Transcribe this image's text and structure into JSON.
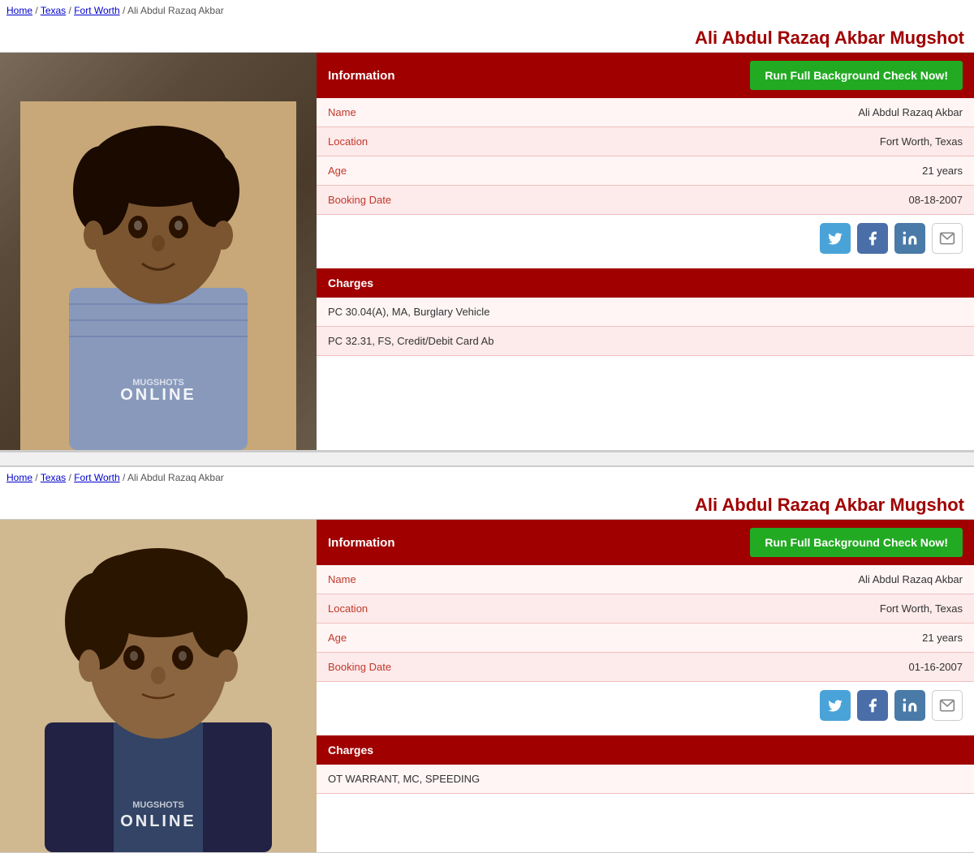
{
  "records": [
    {
      "breadcrumb": {
        "home": "Home",
        "state": "Texas",
        "city": "Fort Worth",
        "name": "Ali Abdul Razaq Akbar"
      },
      "page_title": "Ali Abdul Razaq Akbar Mugshot",
      "info_label": "Information",
      "bg_check_label": "Run Full Background Check Now!",
      "fields": [
        {
          "label": "Name",
          "value": "Ali Abdul Razaq Akbar"
        },
        {
          "label": "Location",
          "value": "Fort Worth, Texas"
        },
        {
          "label": "Age",
          "value": "21 years"
        },
        {
          "label": "Booking Date",
          "value": "08-18-2007"
        }
      ],
      "charges_label": "Charges",
      "charges": [
        "PC 30.04(A), MA, Burglary Vehicle",
        "PC 32.31, FS, Credit/Debit Card Ab"
      ],
      "mugshot_style": "1"
    },
    {
      "breadcrumb": {
        "home": "Home",
        "state": "Texas",
        "city": "Fort Worth",
        "name": "Ali Abdul Razaq Akbar"
      },
      "page_title": "Ali Abdul Razaq Akbar Mugshot",
      "info_label": "Information",
      "bg_check_label": "Run Full Background Check Now!",
      "fields": [
        {
          "label": "Name",
          "value": "Ali Abdul Razaq Akbar"
        },
        {
          "label": "Location",
          "value": "Fort Worth, Texas"
        },
        {
          "label": "Age",
          "value": "21 years"
        },
        {
          "label": "Booking Date",
          "value": "01-16-2007"
        }
      ],
      "charges_label": "Charges",
      "charges": [
        "OT WARRANT, MC, SPEEDING"
      ],
      "mugshot_style": "2"
    }
  ],
  "watermark1": {
    "line1": "MUGSHOTS",
    "line2": "ONLINE",
    "icon": "🐾"
  },
  "watermark2": {
    "line1": "MUGSHOTS",
    "line2": "ONLINE",
    "icon": "🐾"
  },
  "social_icons": {
    "twitter": "🐦",
    "facebook": "f",
    "linkedin": "in",
    "email": "✉"
  }
}
